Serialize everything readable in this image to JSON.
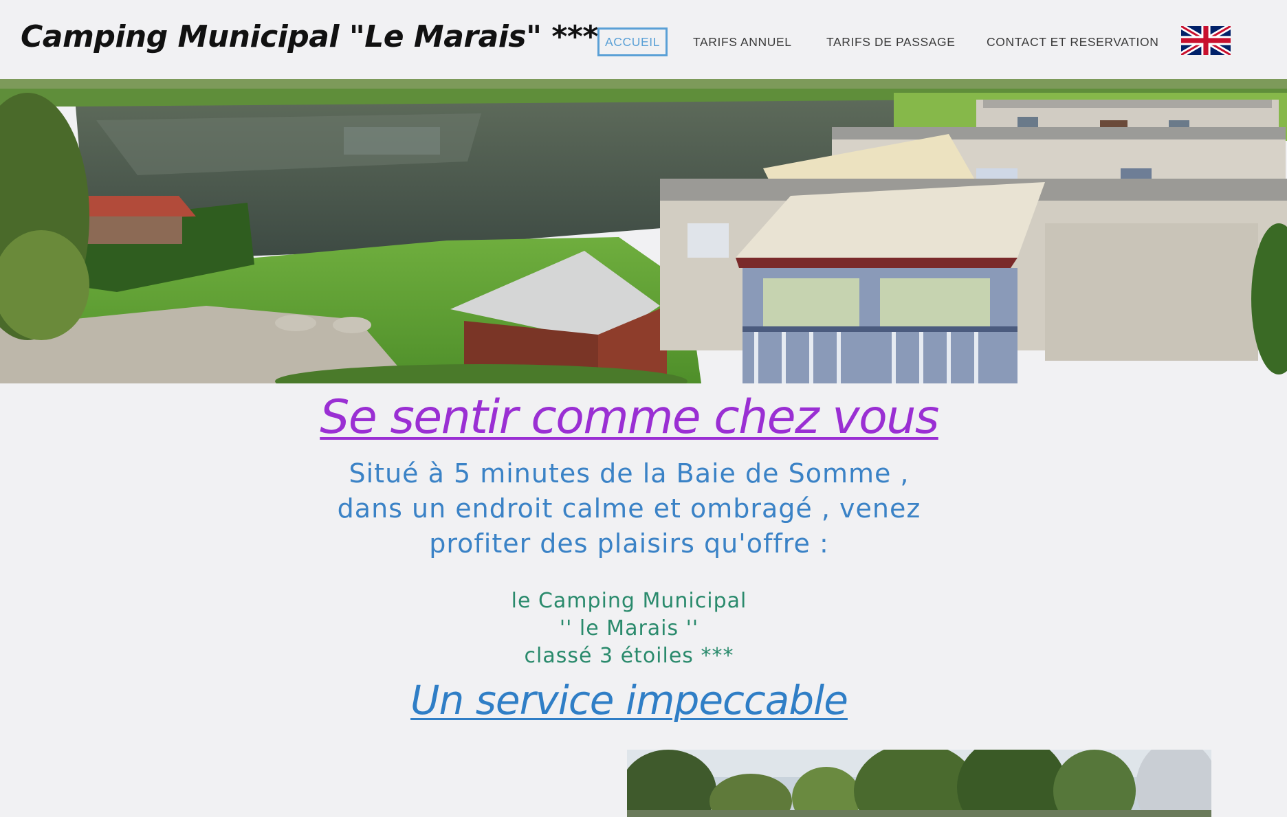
{
  "header": {
    "title": "Camping Municipal \"Le Marais\" ***",
    "nav": [
      {
        "label": "ACCUEIL",
        "active": true
      },
      {
        "label": "TARIFS ANNUEL",
        "active": false
      },
      {
        "label": "TARIFS DE PASSAGE",
        "active": false
      },
      {
        "label": "CONTACT ET RESERVATION",
        "active": false
      }
    ],
    "language_flag": "uk-flag-icon"
  },
  "main": {
    "heading": "Se sentir comme chez vous",
    "intro_lines": [
      "Situé à 5 minutes de la Baie de Somme ,",
      "dans un endroit calme et ombragé , venez",
      "profiter des plaisirs qu'offre :"
    ],
    "camp_lines": [
      "le Camping Municipal",
      "'' le Marais ''",
      "classé 3 étoiles ***"
    ],
    "subheading": "Un service impeccable"
  },
  "colors": {
    "background": "#f1f1f3",
    "heading": "#9a2fd3",
    "intro": "#3a82c6",
    "camp": "#2a8a6c",
    "subheading": "#2f7ec6",
    "nav_active": "#5aa0d6"
  }
}
